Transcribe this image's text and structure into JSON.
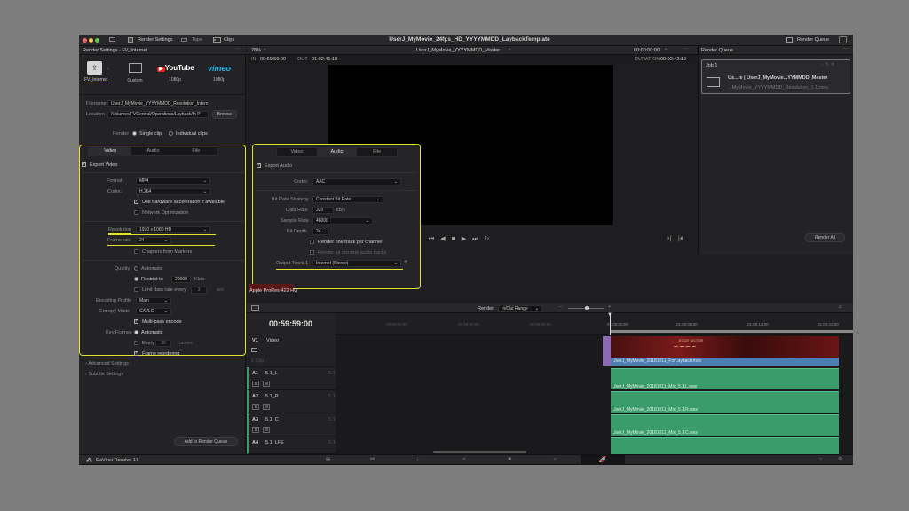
{
  "titlebar": {
    "title": "UserJ_MyMovie_24fps_HD_YYYYMMDD_LaybackTemplate",
    "render_settings": "Render Settings",
    "tape": "Tape",
    "clips": "Clips",
    "render_queue": "Render Queue"
  },
  "render_settings": {
    "panel_title": "Render Settings - FV_Internet",
    "presets": [
      {
        "label": "FV_Internet"
      },
      {
        "label": "Custom"
      },
      {
        "label": "1080p",
        "brand": "YouTube"
      },
      {
        "label": "1080p",
        "brand": "vimeo"
      }
    ],
    "filename_label": "Filename",
    "filename": "UserJ_MyMovie_YYYYMMDD_Resolution_Intern",
    "location_label": "Location",
    "location": "/Volumes/FVCentral/Operations/Layback/In P",
    "browse": "Browse",
    "render_label": "Render",
    "single_clip": "Single clip",
    "individual_clips": "Individual clips",
    "tabs": [
      "Video",
      "Audio",
      "File"
    ],
    "export_video": "Export Video",
    "format_label": "Format",
    "format": "MP4",
    "codec_label": "Codec",
    "codec": "H.264",
    "hw_accel": "Use hardware acceleration if available",
    "network_opt": "Network Optimization",
    "resolution_label": "Resolution",
    "resolution": "1920 x 1080 HD",
    "frame_rate_label": "Frame rate",
    "frame_rate": "24",
    "chapters": "Chapters from Markers",
    "quality_label": "Quality",
    "automatic": "Automatic",
    "restrict_to": "Restrict to",
    "restrict_value": "20000",
    "kbs": "Kb/s",
    "limit_rate": "Limit data rate every",
    "limit_value": "3",
    "sec": "sec",
    "encoding_profile_label": "Encoding Profile",
    "encoding_profile": "Main",
    "entropy_mode_label": "Entropy Mode",
    "entropy_mode": "CAVLC",
    "multipass": "Multi-pass encode",
    "key_frames_label": "Key Frames",
    "kf_automatic": "Automatic",
    "every": "Every",
    "every_value": "30",
    "frames": "frames",
    "frame_reordering": "Frame reordering",
    "advanced": "Advanced Settings",
    "subtitle": "Subtitle Settings",
    "add_to_queue": "Add to Render Queue"
  },
  "audio_panel": {
    "tabs": [
      "Video",
      "Audio",
      "File"
    ],
    "export_audio": "Export Audio",
    "codec_label": "Codec",
    "codec": "AAC",
    "bitrate_strategy_label": "Bit Rate Strategy",
    "bitrate_strategy": "Constant Bit Rate",
    "data_rate_label": "Data Rate",
    "data_rate": "320",
    "kbs": "kb/s",
    "sample_rate_label": "Sample Rate",
    "sample_rate": "48000",
    "bit_depth_label": "Bit Depth",
    "bit_depth": "24",
    "one_track": "Render one track per channel",
    "discrete": "Render as discrete audio tracks",
    "output_track_label": "Output Track 1",
    "output_track": "Internet (Stereo)"
  },
  "viewer": {
    "zoom": "78%",
    "timeline_name": "UserJ_MyMovie_YYYYMMDD_Master",
    "timecode_top": "00:00:00:00",
    "in_label": "IN",
    "in_tc": "00:59:59:00",
    "out_label": "OUT",
    "out_tc": "01:02:41:18",
    "duration_label": "DURATION",
    "duration_tc": "00:02:42:19",
    "apple_prores": "Apple ProRes 422 HQ"
  },
  "render_queue": {
    "job": "Job 1",
    "job_title": "Us...te | UserJ_MyMovie...YYMMDD_Master",
    "job_file": "...MyMovie_YYYYMMDD_Resolution_1.1.mov",
    "render_all": "Render All"
  },
  "timeline": {
    "render_label": "Render",
    "render_range": "In/Out Range",
    "timecode": "00:59:59:00",
    "ruler": [
      "00:59:54:00",
      "00:59:56:00",
      "00:59:58:00",
      "01:00:00:00",
      "01:00:06:00",
      "01:00:14:00",
      "01:00:22:00"
    ],
    "tracks": [
      {
        "id": "V1",
        "name": "Video",
        "extra": "1 Clip",
        "clip": "UserJ_MyMovie_20181011_ForLayback.mov"
      },
      {
        "id": "A1",
        "name": "5.1_L",
        "ch": "5.1",
        "clip": "UserJ_MyMovie_20181011_Mix_5.1.L.wav"
      },
      {
        "id": "A2",
        "name": "5.1_R",
        "ch": "5.1",
        "clip": "UserJ_MyMovie_20181011_Mix_5.1.R.wav"
      },
      {
        "id": "A3",
        "name": "5.1_C",
        "ch": "5.1",
        "clip": "UserJ_MyMovie_20181011_Mix_5.1.C.wav"
      },
      {
        "id": "A4",
        "name": "5.1_LFE",
        "ch": "5.1"
      }
    ],
    "s_label": "S",
    "m_label": "M",
    "video_title_card": "ECCE VICTOR"
  },
  "bottom": {
    "app": "DaVinci Resolve 17"
  },
  "colors": {
    "accent": "#e3e32b",
    "audio_clip": "#3a9c6a",
    "video_clip": "#4a7fb3",
    "active_page": "#d8384a"
  }
}
